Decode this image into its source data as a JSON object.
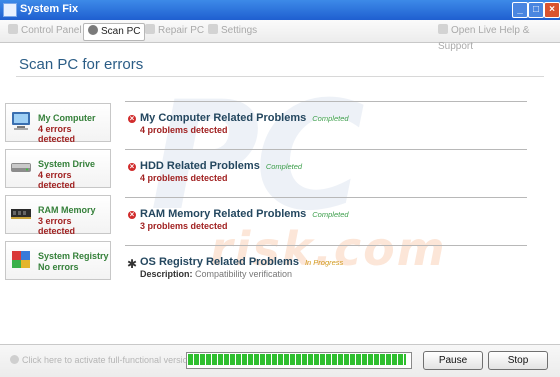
{
  "window": {
    "title": "System Fix"
  },
  "toolbar": {
    "tabs": [
      {
        "label": "Control Panel",
        "icon": "wrench-icon"
      },
      {
        "label": "Scan PC",
        "icon": "scan-icon"
      },
      {
        "label": "Repair PC",
        "icon": "repair-icon"
      },
      {
        "label": "Settings",
        "icon": "settings-icon"
      }
    ],
    "help": "Open Live Help & Support"
  },
  "heading": "Scan PC for errors",
  "watermark": {
    "big": "PC",
    "small": "risk.com"
  },
  "sidebar": [
    {
      "title": "My Computer",
      "status": "4 errors detected",
      "icon": "computer-icon"
    },
    {
      "title": "System Drive",
      "status": "4 errors detected",
      "icon": "drive-icon"
    },
    {
      "title": "RAM Memory",
      "status": "3 errors detected",
      "icon": "memory-icon"
    },
    {
      "title": "System Registry",
      "status": "No errors",
      "icon": "registry-icon"
    }
  ],
  "results": [
    {
      "name": "My Computer Related Problems",
      "status": "Completed",
      "detail": "4 problems detected"
    },
    {
      "name": "HDD Related Problems",
      "status": "Completed",
      "detail": "4 problems detected"
    },
    {
      "name": "RAM Memory Related Problems",
      "status": "Completed",
      "detail": "3 problems detected"
    },
    {
      "name": "OS Registry Related Problems",
      "status": "In Progress",
      "desc_label": "Description:",
      "desc_value": "Compatibility verification"
    }
  ],
  "footer": {
    "activate": "Click here to activate full-functional version",
    "progress": 0.98,
    "pause": "Pause",
    "stop": "Stop"
  },
  "colors": {
    "titlebar": "#1f5fd0",
    "error": "#a12222",
    "ok": "#35803a",
    "progress": "#2fbf2f"
  }
}
